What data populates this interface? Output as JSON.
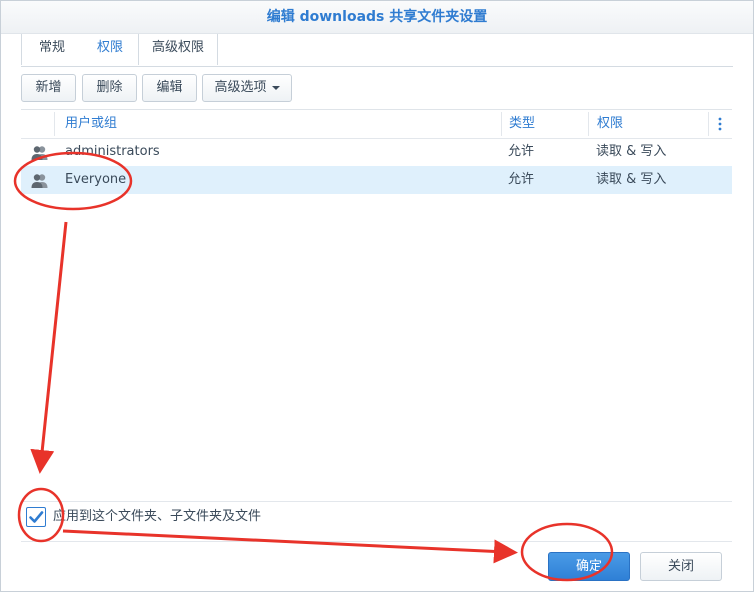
{
  "window": {
    "title": "编辑 downloads 共享文件夹设置"
  },
  "tabs": [
    {
      "label": "常规",
      "active": false
    },
    {
      "label": "权限",
      "active": true
    },
    {
      "label": "高级权限",
      "active": false
    }
  ],
  "toolbar": {
    "add_label": "新增",
    "delete_label": "删除",
    "edit_label": "编辑",
    "advanced_label": "高级选项"
  },
  "grid": {
    "columns": [
      "用户或组",
      "类型",
      "权限"
    ],
    "rows": [
      {
        "name": "administrators",
        "type": "允许",
        "permission": "读取 & 写入",
        "icon": "user-group-icon",
        "selected": false
      },
      {
        "name": "Everyone",
        "type": "允许",
        "permission": "读取 & 写入",
        "icon": "user-group-icon",
        "selected": true
      }
    ]
  },
  "apply_checkbox": {
    "label": "应用到这个文件夹、子文件夹及文件",
    "checked": true
  },
  "buttons": {
    "ok": "确定",
    "close": "关闭"
  },
  "colors": {
    "accent": "#2f7cd1",
    "selected_row": "#dff0fc",
    "annotation": "#e8332a"
  }
}
